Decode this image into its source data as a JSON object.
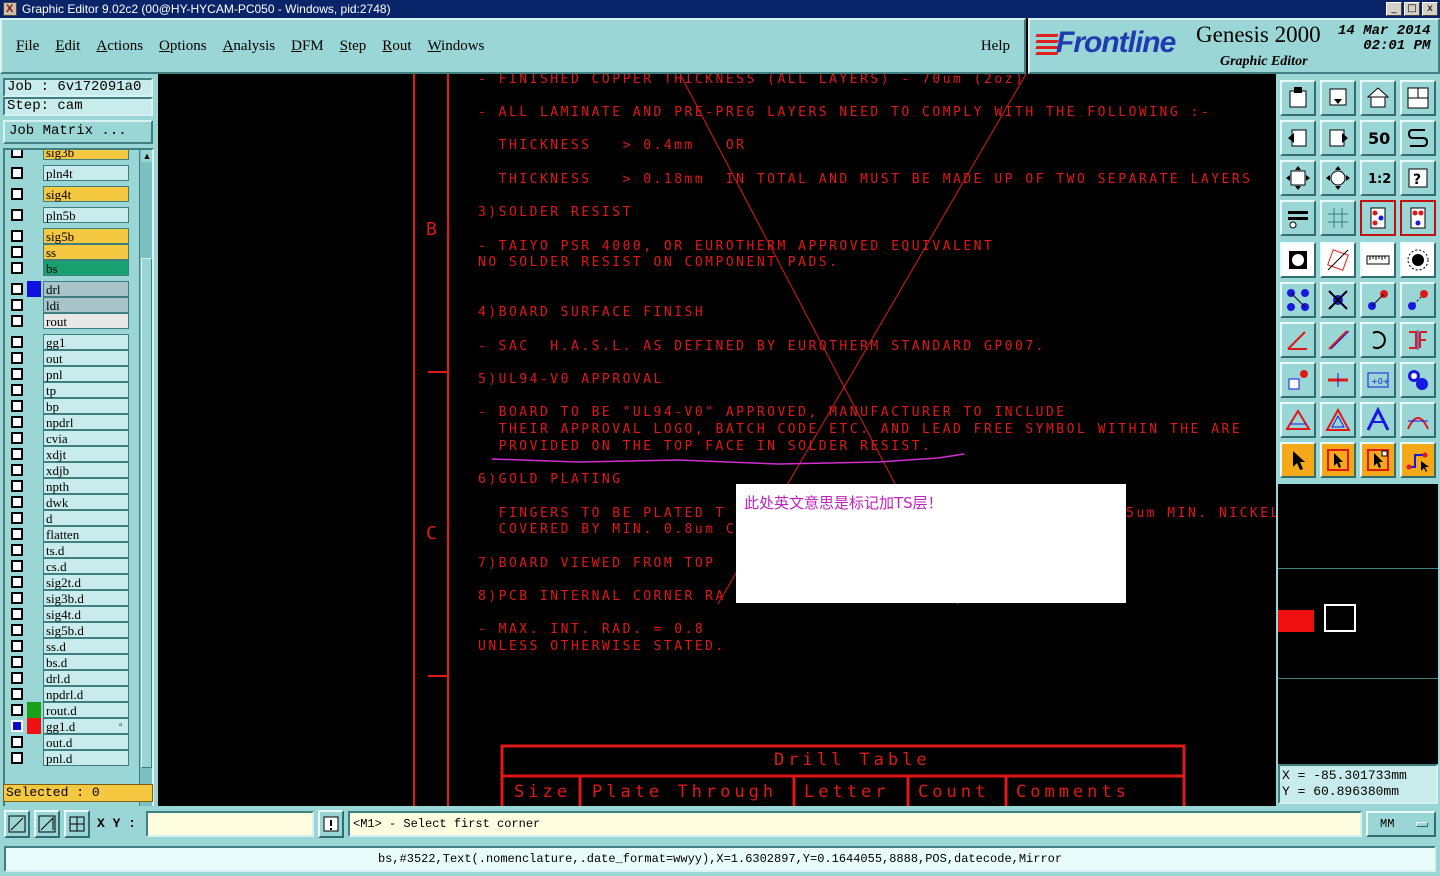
{
  "window": {
    "title": "Graphic Editor 9.02c2 (00@HY-HYCAM-PC050 - Windows, pid:2748)",
    "controls": [
      "_",
      "□",
      "x"
    ]
  },
  "menu": {
    "items": [
      "File",
      "Edit",
      "Actions",
      "Options",
      "Analysis",
      "DFM",
      "Step",
      "Rout",
      "Windows"
    ],
    "help": "Help"
  },
  "logo": {
    "brand": "Frontline",
    "product": "Genesis 2000",
    "subtitle": "Graphic Editor",
    "date": "14 Mar 2014",
    "time": "02:01 PM"
  },
  "left_panel": {
    "job": "Job : 6v172091a0",
    "step": "Step: cam",
    "job_matrix": "Job Matrix ...",
    "selected": "Selected : 0",
    "layers": [
      {
        "name": "sig3b",
        "color": "#f5c842",
        "gap": false
      },
      {
        "name": "pln4t",
        "color": "#c8ecec",
        "gap": true
      },
      {
        "name": "sig4t",
        "color": "#f5c842",
        "gap": true
      },
      {
        "name": "pln5b",
        "color": "#c8ecec",
        "gap": true
      },
      {
        "name": "sig5b",
        "color": "#f5c842",
        "gap": true
      },
      {
        "name": "ss",
        "color": "#f5c842",
        "gap": false
      },
      {
        "name": "bs",
        "color": "#18a070",
        "gap": false
      },
      {
        "name": "drl",
        "color": "#a8c4c8",
        "gap": true,
        "swatch": "#1010e0"
      },
      {
        "name": "ldi",
        "color": "#a8c4c8",
        "gap": false
      },
      {
        "name": "rout",
        "color": "#e8e8e8",
        "gap": false
      },
      {
        "name": "gg1",
        "color": "#c8ecec",
        "gap": true
      },
      {
        "name": "out",
        "color": "#c8ecec",
        "gap": false
      },
      {
        "name": "pnl",
        "color": "#c8ecec",
        "gap": false
      },
      {
        "name": "tp",
        "color": "#c8ecec",
        "gap": false
      },
      {
        "name": "bp",
        "color": "#c8ecec",
        "gap": false
      },
      {
        "name": "npdrl",
        "color": "#c8ecec",
        "gap": false
      },
      {
        "name": "cvia",
        "color": "#c8ecec",
        "gap": false
      },
      {
        "name": "xdjt",
        "color": "#c8ecec",
        "gap": false
      },
      {
        "name": "xdjb",
        "color": "#c8ecec",
        "gap": false
      },
      {
        "name": "npth",
        "color": "#c8ecec",
        "gap": false
      },
      {
        "name": "dwk",
        "color": "#c8ecec",
        "gap": false
      },
      {
        "name": "d",
        "color": "#c8ecec",
        "gap": false
      },
      {
        "name": "flatten",
        "color": "#c8ecec",
        "gap": false
      },
      {
        "name": "ts.d",
        "color": "#c8ecec",
        "gap": false
      },
      {
        "name": "cs.d",
        "color": "#c8ecec",
        "gap": false
      },
      {
        "name": "sig2t.d",
        "color": "#c8ecec",
        "gap": false
      },
      {
        "name": "sig3b.d",
        "color": "#c8ecec",
        "gap": false
      },
      {
        "name": "sig4t.d",
        "color": "#c8ecec",
        "gap": false
      },
      {
        "name": "sig5b.d",
        "color": "#c8ecec",
        "gap": false
      },
      {
        "name": "ss.d",
        "color": "#c8ecec",
        "gap": false
      },
      {
        "name": "bs.d",
        "color": "#c8ecec",
        "gap": false
      },
      {
        "name": "drl.d",
        "color": "#c8ecec",
        "gap": false
      },
      {
        "name": "npdrl.d",
        "color": "#c8ecec",
        "gap": false
      },
      {
        "name": "rout.d",
        "color": "#c8ecec",
        "gap": false,
        "swatch": "#18a018"
      },
      {
        "name": "gg1.d",
        "color": "#c8ecec",
        "gap": false,
        "swatch": "#f01010",
        "selected": true,
        "marker": "▫"
      },
      {
        "name": "out.d",
        "color": "#c8ecec",
        "gap": false
      },
      {
        "name": "pnl.d",
        "color": "#c8ecec",
        "gap": false
      }
    ]
  },
  "canvas": {
    "zone_labels": [
      "B",
      "C"
    ],
    "notes": [
      "- FINISHED COPPER THICKNESS (ALL LAYERS) - 70um (2oz)",
      "- ALL LAMINATE AND PRE-PREG LAYERS NEED TO COMPLY WITH THE FOLLOWING :-",
      "  THICKNESS   > 0.4mm   OR",
      "  THICKNESS   > 0.18mm  IN TOTAL AND MUST BE MADE UP OF TWO SEPARATE LAYERS",
      "3)SOLDER RESIST",
      "- TAIYO PSR 4000, OR EUROTHERM APPROVED EQUIVALENT",
      "NO SOLDER RESIST ON COMPONENT PADS.",
      "4)BOARD SURFACE FINISH",
      "- SAC  H.A.S.L. AS DEFINED BY EUROTHERM STANDARD GP007.",
      "5)UL94-V0 APPROVAL",
      "- BOARD TO BE \"UL94-V0\" APPROVED, MANUFACTURER TO INCLUDE",
      "  THEIR APPROVAL LOGO, BATCH CODE ETC. AND LEAD FREE SYMBOL WITHIN THE ARE",
      "  PROVIDED ON THE TOP FACE IN SOLDER RESIST.",
      "6)GOLD PLATING",
      "  FINGERS TO BE PLATED T",
      "5um MIN. NICKEL",
      "  COVERED BY MIN. 0.8um C",
      "7)BOARD VIEWED FROM TOP",
      "8)PCB INTERNAL CORNER RA",
      "- MAX. INT. RAD. = 0.8",
      "UNLESS OTHERWISE STATED."
    ],
    "popup_text": "此处英文意思是标记加TS层！",
    "drill_table": {
      "title": "Drill Table",
      "columns": [
        "Size",
        "Plate Through",
        "Letter",
        "Count",
        "Comments"
      ]
    }
  },
  "right_panel": {
    "tools_top": [
      "open-icon",
      "save-icon",
      "home-icon",
      "window-icon",
      "back-icon",
      "forward-icon",
      "swap-icon",
      "s-curve-icon",
      "fit-icon",
      "center-icon",
      "scale-1-2-icon",
      "help-icon",
      "ruler-icon",
      "grid-icon",
      "layer-red-icon",
      "layer-red-2-icon"
    ],
    "tools_bottom": [
      "pad-icon",
      "line-icon",
      "measure-icon",
      "dot-icon",
      "connect-icon",
      "cross-icon",
      "add-point-icon",
      "move-point-icon",
      "angle-icon",
      "slash-icon",
      "arc-icon",
      "mirror-icon",
      "pick-icon",
      "minus-icon",
      "dimension-icon",
      "blob-icon",
      "tri-icon",
      "tri-2-icon",
      "tri-3-icon",
      "tri-4-icon",
      "pointer-icon",
      "pointer-2-icon",
      "pointer-3-icon",
      "route-icon"
    ],
    "coord_x": "X =  -85.301733mm",
    "coord_y": "Y =   60.896380mm"
  },
  "bottom_bar": {
    "xy_label": "X Y :",
    "xy_value": "",
    "prompt": "<M1> - Select first corner",
    "units": "MM"
  },
  "status": "bs,#3522,Text(.nomenclature,.date_format=wwyy),X=1.6302897,Y=0.1644055,8888,POS,datecode,Mirror"
}
